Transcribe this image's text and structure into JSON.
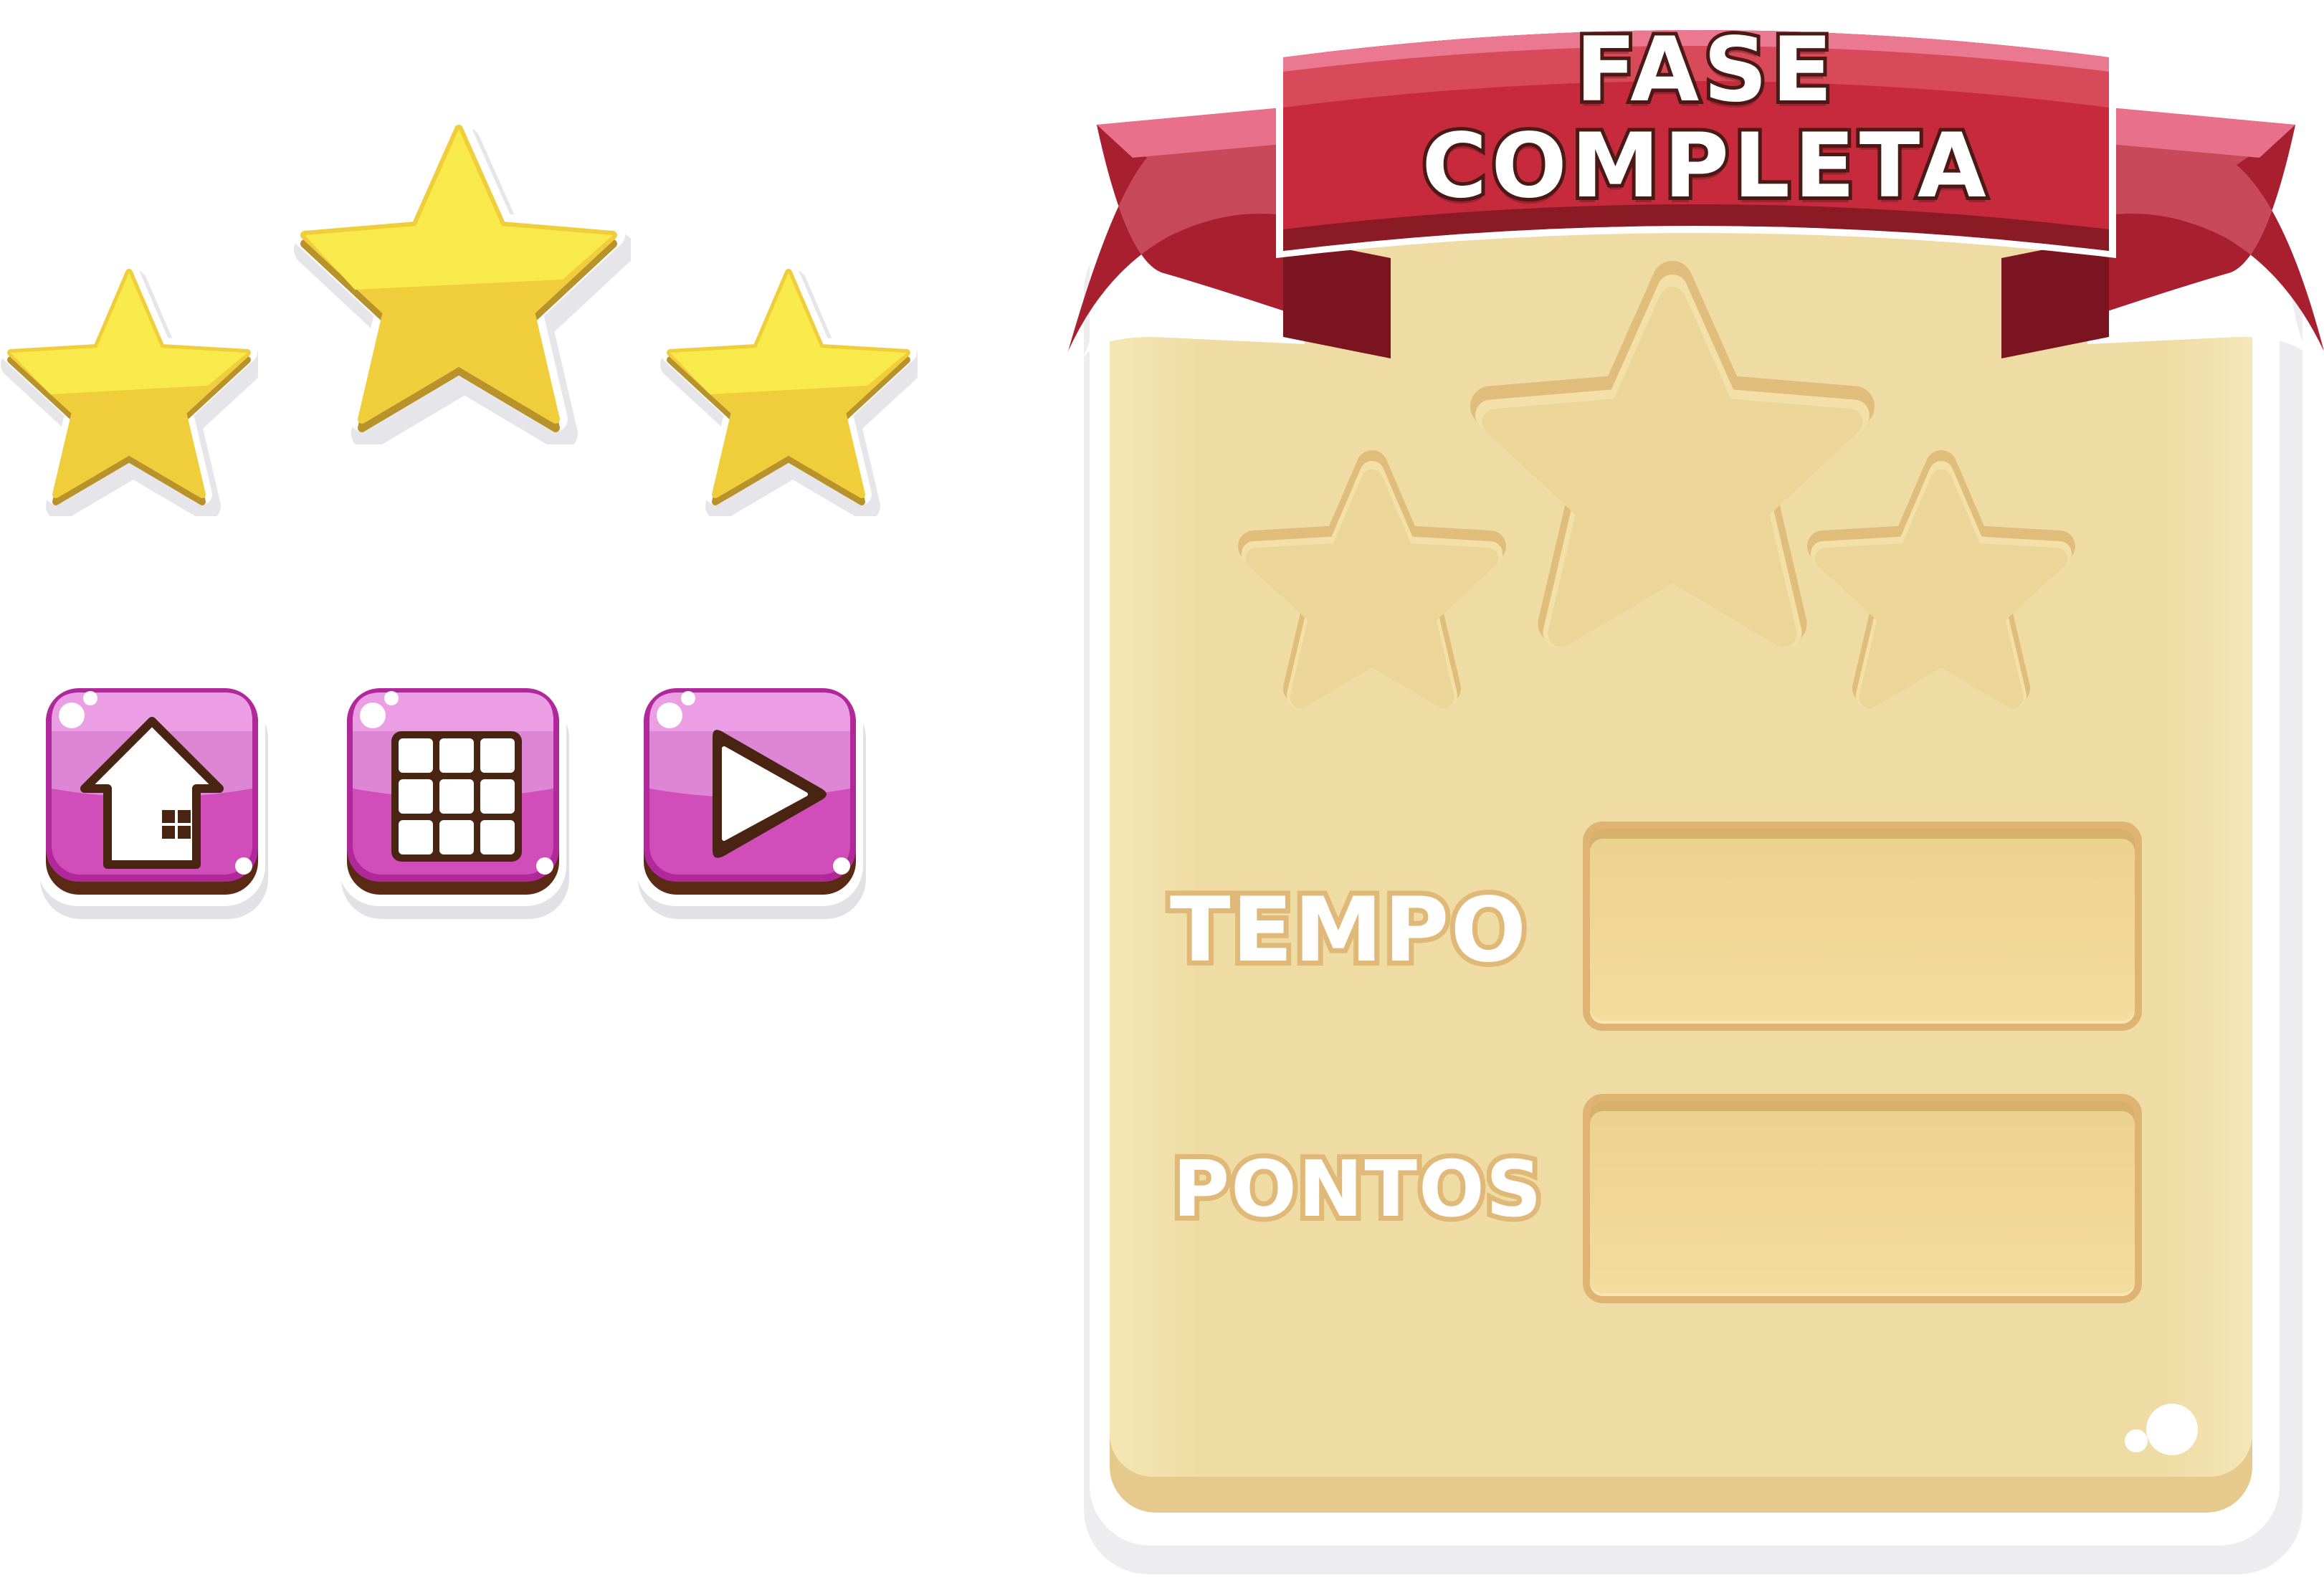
{
  "banner": {
    "line1": "FASE",
    "line2": "COMPLETA"
  },
  "result_panel": {
    "stars_earned": 0,
    "stars_total": 3,
    "fields": [
      {
        "label": "TEMPO",
        "value": ""
      },
      {
        "label": "PONTOS",
        "value": ""
      }
    ]
  },
  "rating_stars": {
    "count": 3,
    "earned": 3
  },
  "buttons": [
    {
      "name": "home",
      "icon": "house-icon"
    },
    {
      "name": "levels",
      "icon": "grid-icon"
    },
    {
      "name": "play",
      "icon": "play-icon"
    }
  ],
  "colors": {
    "star_gold": "#f4d83a",
    "button_magenta": "#c43fae",
    "ribbon_red": "#c8283a",
    "panel_cream": "#f2e2aa",
    "outline_brown": "#4a2412"
  }
}
